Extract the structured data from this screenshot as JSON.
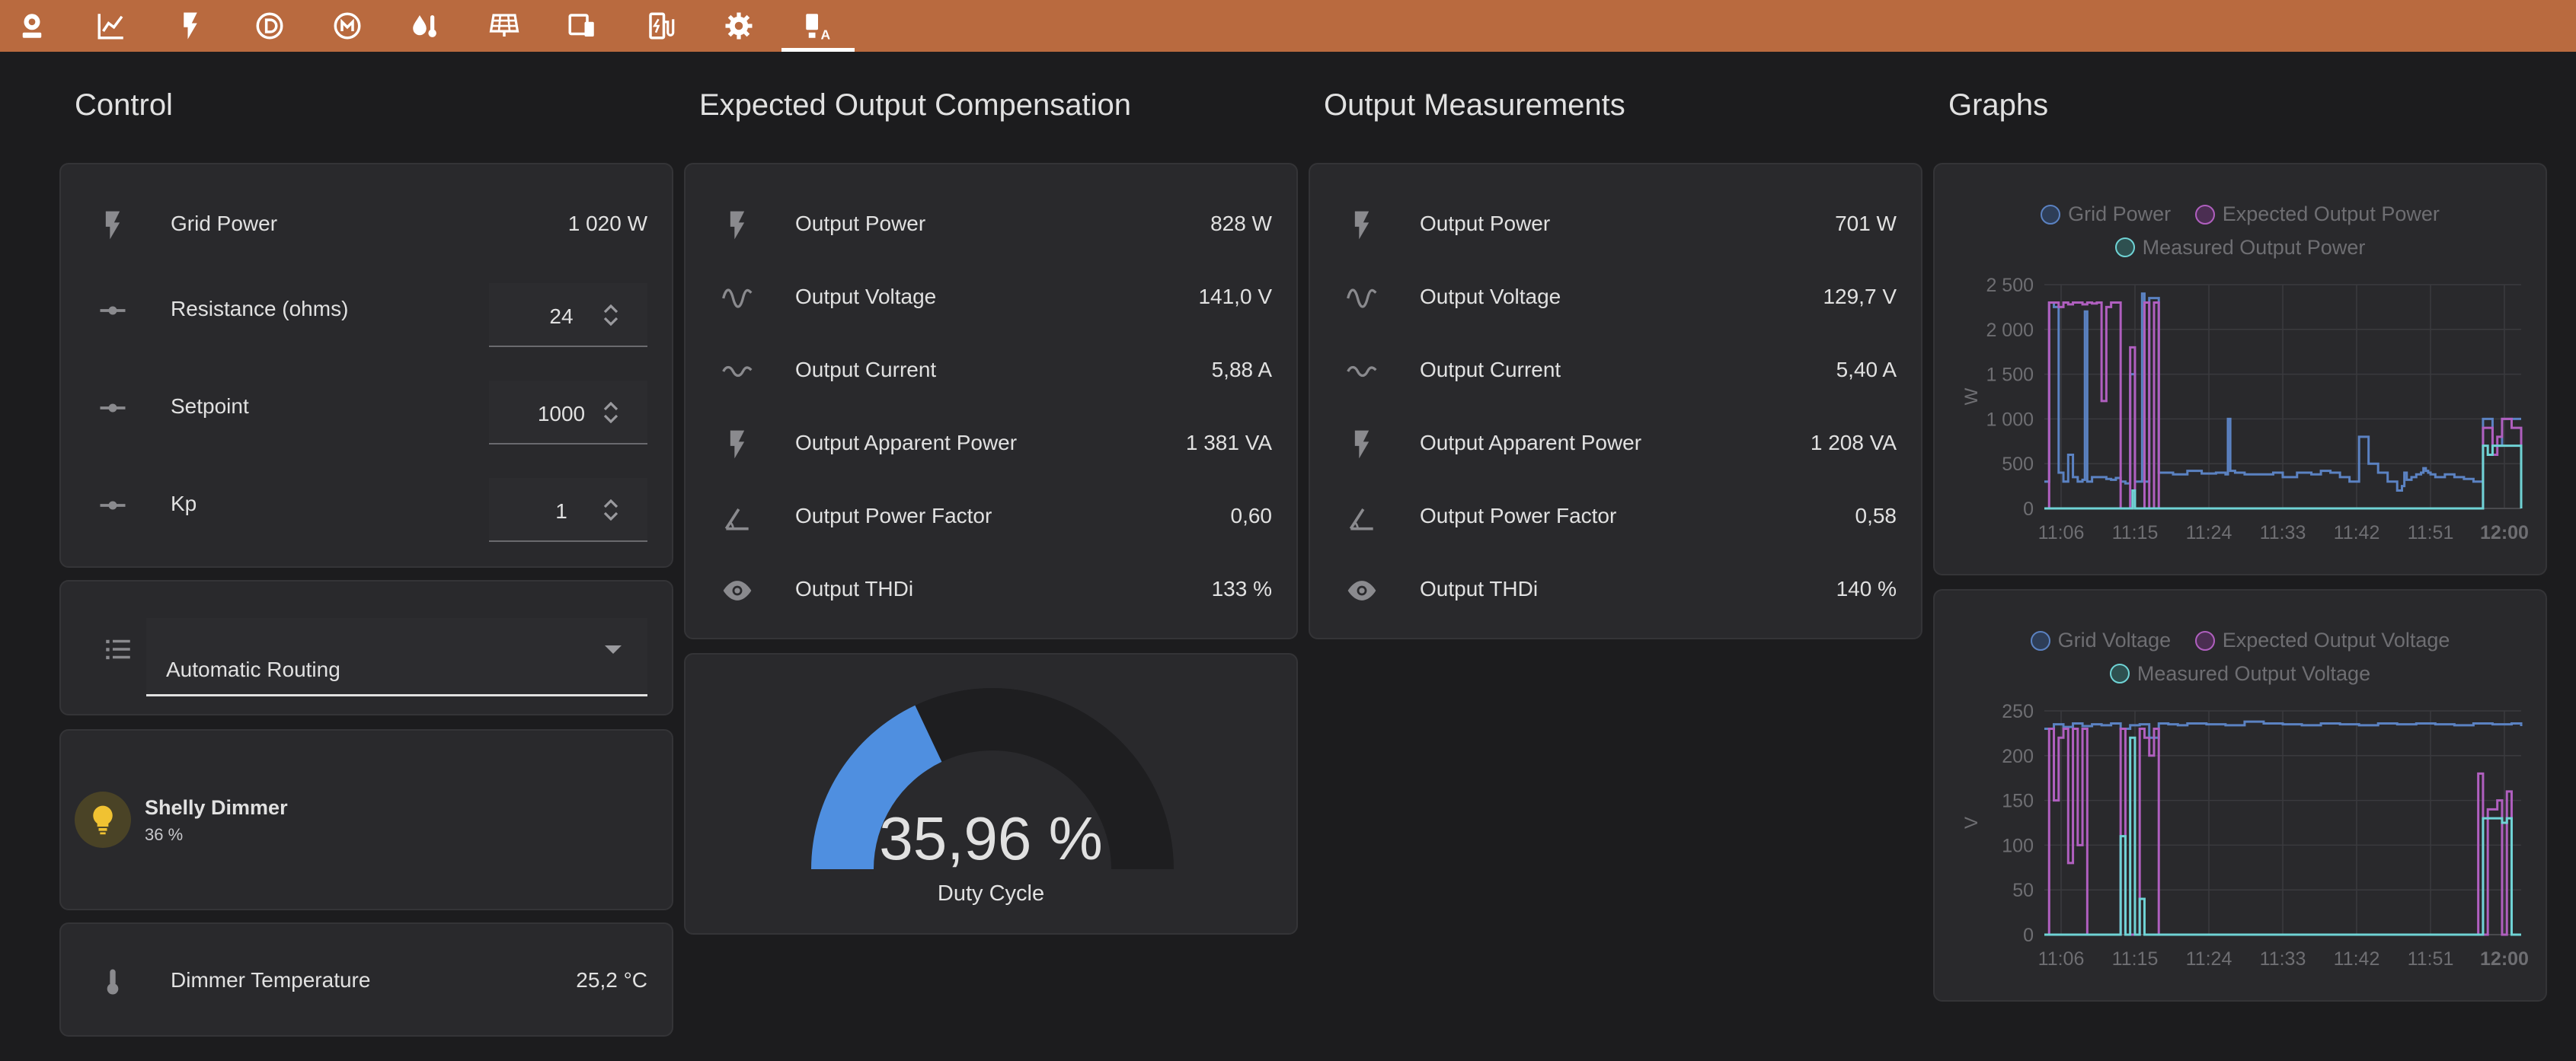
{
  "colors": {
    "topbar": "#b96a3f",
    "grid_series": "#5b82c2",
    "expected_series": "#b05fbf",
    "measured_series": "#6fd3d5",
    "gauge_fill": "#4f8fe0",
    "bulb": "#f0c232"
  },
  "tabs": [
    {
      "icon": "webcam-icon"
    },
    {
      "icon": "chart-line-icon"
    },
    {
      "icon": "flash-icon"
    },
    {
      "icon": "alpha-d-circle-icon"
    },
    {
      "icon": "alpha-m-circle-icon"
    },
    {
      "icon": "water-thermometer-icon"
    },
    {
      "icon": "solar-panel-icon"
    },
    {
      "icon": "devices-icon"
    },
    {
      "icon": "ev-station-icon"
    },
    {
      "icon": "cog-icon"
    },
    {
      "icon": "ev-plug-a-icon",
      "active": true
    }
  ],
  "control": {
    "title": "Control",
    "grid_power": {
      "label": "Grid Power",
      "value": "1 020 W"
    },
    "resistance": {
      "label": "Resistance (ohms)",
      "value": "24"
    },
    "setpoint": {
      "label": "Setpoint",
      "value": "1000"
    },
    "kp": {
      "label": "Kp",
      "value": "1"
    },
    "mode": {
      "value": "Automatic Routing"
    },
    "dimmer": {
      "name": "Shelly Dimmer",
      "state": "36 %"
    },
    "temperature": {
      "label": "Dimmer Temperature",
      "value": "25,2 °C"
    }
  },
  "expected": {
    "title": "Expected Output Compensation",
    "rows": [
      {
        "icon": "flash-icon",
        "label": "Output Power",
        "value": "828 W"
      },
      {
        "icon": "sine-wave-icon",
        "label": "Output Voltage",
        "value": "141,0 V"
      },
      {
        "icon": "current-ac-icon",
        "label": "Output Current",
        "value": "5,88 A"
      },
      {
        "icon": "flash-icon",
        "label": "Output Apparent Power",
        "value": "1 381 VA"
      },
      {
        "icon": "angle-acute-icon",
        "label": "Output Power Factor",
        "value": "0,60"
      },
      {
        "icon": "eye-icon",
        "label": "Output THDi",
        "value": "133 %"
      }
    ],
    "gauge": {
      "value": "35,96 %",
      "fraction": 0.3596,
      "label": "Duty Cycle"
    }
  },
  "measurements": {
    "title": "Output Measurements",
    "rows": [
      {
        "icon": "flash-icon",
        "label": "Output Power",
        "value": "701 W"
      },
      {
        "icon": "sine-wave-icon",
        "label": "Output Voltage",
        "value": "129,7 V"
      },
      {
        "icon": "current-ac-icon",
        "label": "Output Current",
        "value": "5,40 A"
      },
      {
        "icon": "flash-icon",
        "label": "Output Apparent Power",
        "value": "1 208 VA"
      },
      {
        "icon": "angle-acute-icon",
        "label": "Output Power Factor",
        "value": "0,58"
      },
      {
        "icon": "eye-icon",
        "label": "Output THDi",
        "value": "140 %"
      }
    ]
  },
  "graphs": {
    "title": "Graphs"
  },
  "chart_data": [
    {
      "type": "line",
      "legend_placement": "top-center",
      "ylabel": "W",
      "ylim": [
        0,
        2500
      ],
      "yticks": [
        "0",
        "500",
        "1 000",
        "1 500",
        "2 000",
        "2 500"
      ],
      "xticks": [
        "11:06",
        "11:15",
        "11:24",
        "11:33",
        "11:42",
        "11:51",
        "12:00"
      ],
      "grid": true,
      "series": [
        {
          "name": "Grid Power",
          "color": "#5b82c2",
          "x": [
            0,
            1,
            2,
            3,
            4,
            5,
            6,
            7,
            8,
            8.5,
            9,
            10,
            12,
            13,
            14,
            15,
            16,
            17,
            18,
            19,
            20,
            20.5,
            21,
            22,
            24,
            27,
            30,
            33,
            36,
            38,
            38.5,
            39,
            40,
            42,
            45,
            48,
            50,
            53,
            56,
            58,
            60,
            62,
            64,
            66,
            68,
            70,
            72,
            74,
            75,
            75.5,
            76,
            77,
            78,
            79,
            79.5,
            80,
            80.5,
            81,
            82,
            84,
            86,
            88,
            90,
            92,
            94,
            96,
            98,
            100
          ],
          "values": [
            300,
            2300,
            2250,
            400,
            300,
            600,
            350,
            300,
            320,
            2200,
            300,
            350,
            350,
            330,
            320,
            340,
            300,
            280,
            1500,
            300,
            300,
            2400,
            300,
            2350,
            400,
            380,
            420,
            390,
            400,
            380,
            1000,
            420,
            400,
            380,
            380,
            400,
            350,
            400,
            380,
            420,
            400,
            350,
            300,
            800,
            500,
            400,
            300,
            200,
            250,
            400,
            320,
            350,
            380,
            400,
            450,
            420,
            400,
            380,
            350,
            380,
            350,
            330,
            300,
            1000,
            700,
            1000,
            1000,
            1000
          ]
        },
        {
          "name": "Expected Output Power",
          "color": "#b05fbf",
          "x": [
            0,
            1,
            2,
            3,
            4,
            5,
            6,
            7,
            8,
            9,
            10,
            11,
            12,
            13,
            14,
            15,
            16,
            17,
            18,
            19,
            20,
            21,
            22,
            23,
            24,
            26,
            28,
            30,
            32,
            40,
            50,
            60,
            70,
            80,
            90,
            92,
            94,
            95,
            96,
            98,
            100
          ],
          "values": [
            0,
            2300,
            2300,
            2250,
            2300,
            2280,
            2300,
            2300,
            2280,
            2300,
            2290,
            2300,
            1200,
            2250,
            2300,
            2300,
            0,
            0,
            1800,
            0,
            0,
            2300,
            0,
            2300,
            0,
            0,
            0,
            0,
            0,
            0,
            0,
            0,
            0,
            0,
            0,
            900,
            600,
            800,
            1000,
            900,
            0
          ]
        },
        {
          "name": "Measured Output Power",
          "color": "#6fd3d5",
          "x": [
            0,
            18,
            18.5,
            19,
            20,
            21,
            22,
            30,
            50,
            70,
            90,
            92,
            93,
            94,
            96,
            98,
            100
          ],
          "values": [
            0,
            0,
            200,
            0,
            0,
            0,
            0,
            0,
            0,
            0,
            0,
            700,
            600,
            700,
            700,
            700,
            0
          ]
        }
      ]
    },
    {
      "type": "line",
      "legend_placement": "top-center",
      "ylabel": "V",
      "ylim": [
        0,
        250
      ],
      "yticks": [
        "0",
        "50",
        "100",
        "150",
        "200",
        "250"
      ],
      "xticks": [
        "11:06",
        "11:15",
        "11:24",
        "11:33",
        "11:42",
        "11:51",
        "12:00"
      ],
      "grid": true,
      "series": [
        {
          "name": "Grid Voltage",
          "color": "#5b82c2",
          "x": [
            0,
            2,
            4,
            6,
            8,
            10,
            12,
            14,
            16,
            18,
            20,
            22,
            24,
            26,
            28,
            30,
            34,
            38,
            42,
            46,
            50,
            54,
            58,
            62,
            66,
            70,
            74,
            78,
            82,
            86,
            90,
            94,
            98,
            100
          ],
          "values": [
            230,
            235,
            232,
            236,
            233,
            235,
            234,
            236,
            230,
            234,
            235,
            220,
            236,
            235,
            234,
            236,
            235,
            234,
            238,
            236,
            235,
            234,
            236,
            235,
            234,
            236,
            235,
            236,
            235,
            234,
            236,
            235,
            236,
            233
          ]
        },
        {
          "name": "Expected Output Voltage",
          "color": "#b05fbf",
          "x": [
            0,
            1,
            2,
            3,
            4,
            5,
            6,
            7,
            8,
            9,
            10,
            12,
            14,
            16,
            17,
            18,
            19,
            20,
            21,
            22,
            23,
            24,
            25,
            30,
            40,
            50,
            60,
            70,
            80,
            88,
            90,
            91,
            92,
            93,
            94,
            95,
            96,
            97,
            98,
            100
          ],
          "values": [
            0,
            230,
            150,
            220,
            230,
            80,
            230,
            100,
            230,
            0,
            0,
            0,
            0,
            230,
            0,
            0,
            0,
            230,
            220,
            200,
            230,
            0,
            0,
            0,
            0,
            0,
            0,
            0,
            0,
            0,
            0,
            180,
            0,
            140,
            140,
            150,
            0,
            160,
            0,
            0
          ]
        },
        {
          "name": "Measured Output Voltage",
          "color": "#6fd3d5",
          "x": [
            0,
            10,
            15,
            16,
            17,
            18,
            19,
            20,
            21,
            22,
            23,
            24,
            30,
            50,
            70,
            90,
            91,
            92,
            94,
            96,
            97,
            98,
            100
          ],
          "values": [
            0,
            0,
            0,
            110,
            0,
            220,
            0,
            40,
            0,
            0,
            0,
            0,
            0,
            0,
            0,
            0,
            0,
            130,
            130,
            125,
            130,
            0,
            0
          ]
        }
      ]
    }
  ]
}
